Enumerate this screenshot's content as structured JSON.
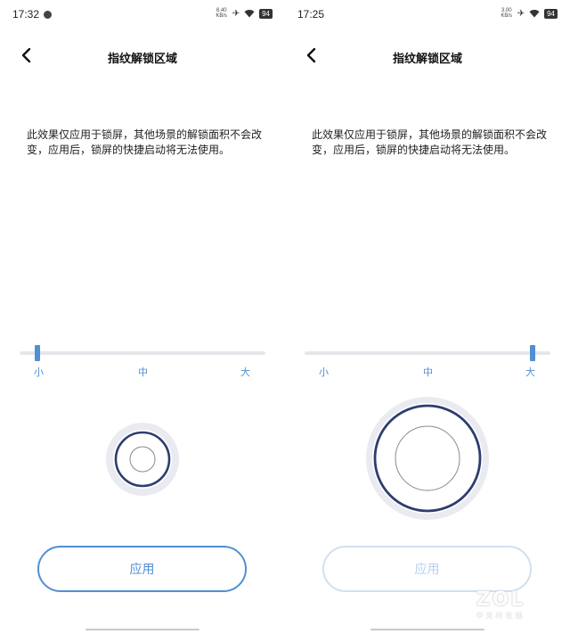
{
  "screens": [
    {
      "status": {
        "time": "17:32",
        "net_speed": "8.40 KB/s",
        "battery": "94"
      },
      "nav": {
        "title": "指纹解锁区域"
      },
      "description": "此效果仅应用于锁屏，其他场景的解锁面积不会改变，应用后，锁屏的快捷启动将无法使用。",
      "slider": {
        "labels": [
          "小",
          "中",
          "大"
        ],
        "selected": "小",
        "level": 0
      },
      "apply_button": {
        "label": "应用",
        "enabled": true
      }
    },
    {
      "status": {
        "time": "17:25",
        "net_speed": "3.00 KB/s",
        "battery": "94"
      },
      "nav": {
        "title": "指纹解锁区域"
      },
      "description": "此效果仅应用于锁屏，其他场景的解锁面积不会改变，应用后，锁屏的快捷启动将无法使用。",
      "slider": {
        "labels": [
          "小",
          "中",
          "大"
        ],
        "selected": "大",
        "level": 1
      },
      "apply_button": {
        "label": "应用",
        "enabled": false
      }
    }
  ],
  "watermark": {
    "logo": "ZOL",
    "subtitle": "中关村在线"
  },
  "colors": {
    "accent": "#4f8fd3",
    "ring_dark": "#2f3d6e",
    "ring_light": "#e9ebf1",
    "track": "#e6e6ea"
  },
  "icons": {
    "back": "chevron-left-icon",
    "airplane": "airplane-icon",
    "wifi": "wifi-icon",
    "battery": "battery-icon"
  }
}
